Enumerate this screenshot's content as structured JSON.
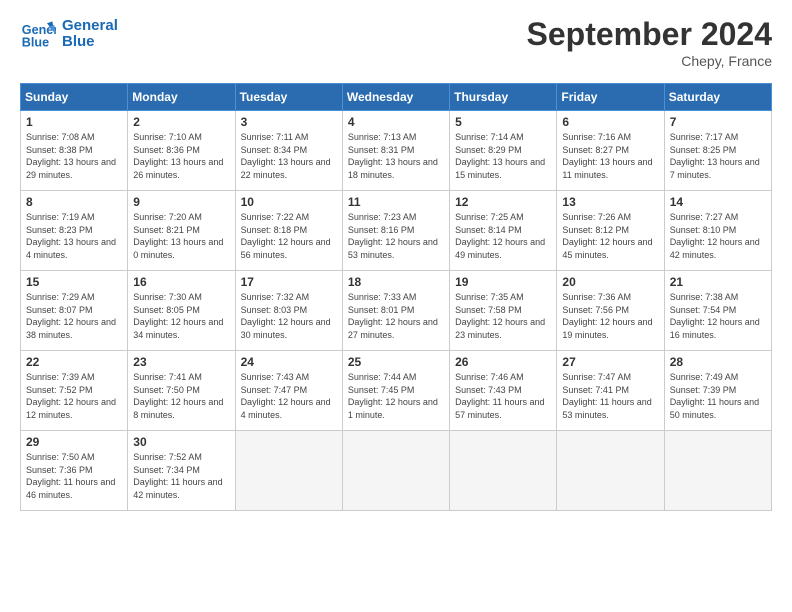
{
  "header": {
    "logo_line1": "General",
    "logo_line2": "Blue",
    "month": "September 2024",
    "location": "Chepy, France"
  },
  "weekdays": [
    "Sunday",
    "Monday",
    "Tuesday",
    "Wednesday",
    "Thursday",
    "Friday",
    "Saturday"
  ],
  "weeks": [
    [
      {
        "day": "1",
        "sunrise": "7:08 AM",
        "sunset": "8:38 PM",
        "daylight": "13 hours and 29 minutes."
      },
      {
        "day": "2",
        "sunrise": "7:10 AM",
        "sunset": "8:36 PM",
        "daylight": "13 hours and 26 minutes."
      },
      {
        "day": "3",
        "sunrise": "7:11 AM",
        "sunset": "8:34 PM",
        "daylight": "13 hours and 22 minutes."
      },
      {
        "day": "4",
        "sunrise": "7:13 AM",
        "sunset": "8:31 PM",
        "daylight": "13 hours and 18 minutes."
      },
      {
        "day": "5",
        "sunrise": "7:14 AM",
        "sunset": "8:29 PM",
        "daylight": "13 hours and 15 minutes."
      },
      {
        "day": "6",
        "sunrise": "7:16 AM",
        "sunset": "8:27 PM",
        "daylight": "13 hours and 11 minutes."
      },
      {
        "day": "7",
        "sunrise": "7:17 AM",
        "sunset": "8:25 PM",
        "daylight": "13 hours and 7 minutes."
      }
    ],
    [
      {
        "day": "8",
        "sunrise": "7:19 AM",
        "sunset": "8:23 PM",
        "daylight": "13 hours and 4 minutes."
      },
      {
        "day": "9",
        "sunrise": "7:20 AM",
        "sunset": "8:21 PM",
        "daylight": "13 hours and 0 minutes."
      },
      {
        "day": "10",
        "sunrise": "7:22 AM",
        "sunset": "8:18 PM",
        "daylight": "12 hours and 56 minutes."
      },
      {
        "day": "11",
        "sunrise": "7:23 AM",
        "sunset": "8:16 PM",
        "daylight": "12 hours and 53 minutes."
      },
      {
        "day": "12",
        "sunrise": "7:25 AM",
        "sunset": "8:14 PM",
        "daylight": "12 hours and 49 minutes."
      },
      {
        "day": "13",
        "sunrise": "7:26 AM",
        "sunset": "8:12 PM",
        "daylight": "12 hours and 45 minutes."
      },
      {
        "day": "14",
        "sunrise": "7:27 AM",
        "sunset": "8:10 PM",
        "daylight": "12 hours and 42 minutes."
      }
    ],
    [
      {
        "day": "15",
        "sunrise": "7:29 AM",
        "sunset": "8:07 PM",
        "daylight": "12 hours and 38 minutes."
      },
      {
        "day": "16",
        "sunrise": "7:30 AM",
        "sunset": "8:05 PM",
        "daylight": "12 hours and 34 minutes."
      },
      {
        "day": "17",
        "sunrise": "7:32 AM",
        "sunset": "8:03 PM",
        "daylight": "12 hours and 30 minutes."
      },
      {
        "day": "18",
        "sunrise": "7:33 AM",
        "sunset": "8:01 PM",
        "daylight": "12 hours and 27 minutes."
      },
      {
        "day": "19",
        "sunrise": "7:35 AM",
        "sunset": "7:58 PM",
        "daylight": "12 hours and 23 minutes."
      },
      {
        "day": "20",
        "sunrise": "7:36 AM",
        "sunset": "7:56 PM",
        "daylight": "12 hours and 19 minutes."
      },
      {
        "day": "21",
        "sunrise": "7:38 AM",
        "sunset": "7:54 PM",
        "daylight": "12 hours and 16 minutes."
      }
    ],
    [
      {
        "day": "22",
        "sunrise": "7:39 AM",
        "sunset": "7:52 PM",
        "daylight": "12 hours and 12 minutes."
      },
      {
        "day": "23",
        "sunrise": "7:41 AM",
        "sunset": "7:50 PM",
        "daylight": "12 hours and 8 minutes."
      },
      {
        "day": "24",
        "sunrise": "7:43 AM",
        "sunset": "7:47 PM",
        "daylight": "12 hours and 4 minutes."
      },
      {
        "day": "25",
        "sunrise": "7:44 AM",
        "sunset": "7:45 PM",
        "daylight": "12 hours and 1 minute."
      },
      {
        "day": "26",
        "sunrise": "7:46 AM",
        "sunset": "7:43 PM",
        "daylight": "11 hours and 57 minutes."
      },
      {
        "day": "27",
        "sunrise": "7:47 AM",
        "sunset": "7:41 PM",
        "daylight": "11 hours and 53 minutes."
      },
      {
        "day": "28",
        "sunrise": "7:49 AM",
        "sunset": "7:39 PM",
        "daylight": "11 hours and 50 minutes."
      }
    ],
    [
      {
        "day": "29",
        "sunrise": "7:50 AM",
        "sunset": "7:36 PM",
        "daylight": "11 hours and 46 minutes."
      },
      {
        "day": "30",
        "sunrise": "7:52 AM",
        "sunset": "7:34 PM",
        "daylight": "11 hours and 42 minutes."
      },
      null,
      null,
      null,
      null,
      null
    ]
  ],
  "labels": {
    "sunrise": "Sunrise:",
    "sunset": "Sunset:",
    "daylight": "Daylight:"
  }
}
